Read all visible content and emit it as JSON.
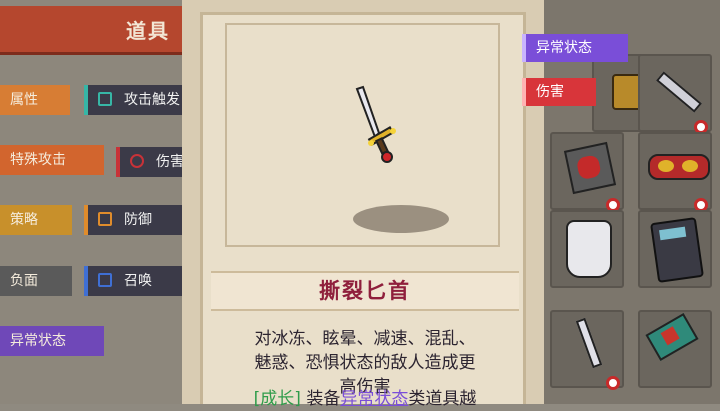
{
  "header": {
    "title": "道具"
  },
  "categories": [
    {
      "label": "属性",
      "color": "#d77d34"
    },
    {
      "label": "特殊攻击",
      "color": "#d2652e"
    },
    {
      "label": "策略",
      "color": "#c8902b"
    },
    {
      "label": "负面",
      "color": "#5a5a5a"
    },
    {
      "label": "异常状态",
      "color": "#6f48b8"
    }
  ],
  "subchips": [
    {
      "label": "攻击触发",
      "color": "#37b6a6"
    },
    {
      "label": "伤害",
      "color": "#c83238"
    },
    {
      "label": "防御",
      "color": "#e08c2c"
    },
    {
      "label": "召唤",
      "color": "#3f6fd4"
    }
  ],
  "item": {
    "name": "撕裂匕首",
    "desc_line1": "对冰冻、眩晕、减速、混乱、",
    "desc_line2": "魅惑、恐惧状态的敌人造成更",
    "desc_line3": "高伤害",
    "growth_tag": "[成长]",
    "growth_text1": " 装备",
    "growth_link": "异常状态",
    "growth_text2": "类道具越"
  },
  "filters": [
    {
      "label": "异常状态",
      "color": "#7a4ed8"
    },
    {
      "label": "伤害",
      "color": "#d8353a"
    }
  ],
  "inventory": [
    {
      "icon": "bag-icon"
    },
    {
      "icon": "wrench-icon"
    },
    {
      "icon": "red-hand-icon"
    },
    {
      "icon": "goggles-icon"
    },
    {
      "icon": "glove-icon"
    },
    {
      "icon": "calculator-icon"
    },
    {
      "icon": "dagger-icon"
    },
    {
      "icon": "hammer-icon"
    }
  ]
}
